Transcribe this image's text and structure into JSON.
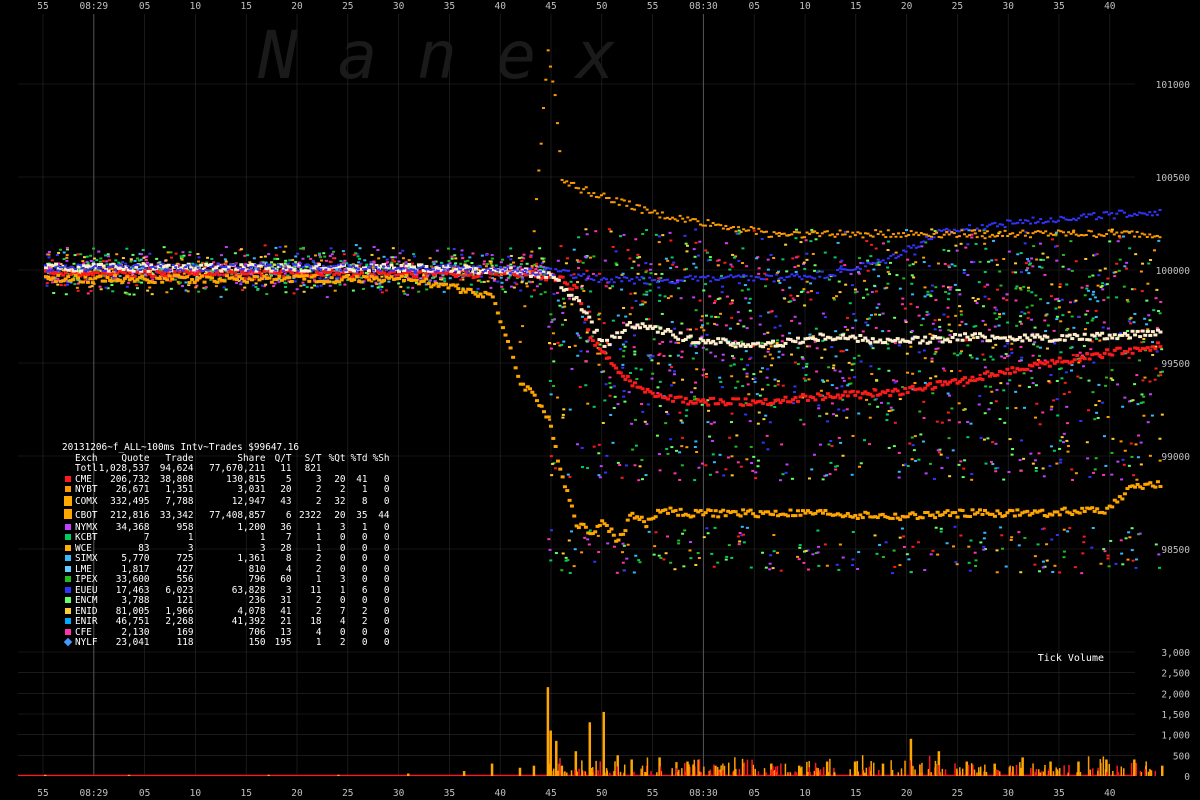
{
  "watermark": "N a n e x",
  "colors": {
    "background": "#000000",
    "grid": "#2a2a2a",
    "axis_text": "#c0c0c0",
    "vline": "#555555",
    "CME": "#ff1a1a",
    "NYBT": "#ff9900",
    "COMX": "#ffaa00",
    "CBOT": "#ffa500",
    "NYMX": "#c040ff",
    "KCBT": "#00cc66",
    "WCE": "#ffb000",
    "SIMX": "#33bbff",
    "LME": "#66ccff",
    "IPEX": "#22bb22",
    "EUEU": "#3333ff",
    "ENCM": "#66ff66",
    "ENID": "#ffcc33",
    "ENIR": "#00aaff",
    "CFE": "#ff33aa",
    "NYLF": "#4499ff",
    "band_white": "#ffeecc"
  },
  "x_axis_top": [
    "55",
    "08:29",
    "05",
    "10",
    "15",
    "20",
    "25",
    "30",
    "35",
    "40",
    "45",
    "50",
    "55",
    "08:30",
    "05",
    "10",
    "15",
    "20",
    "25",
    "30",
    "35",
    "40"
  ],
  "x_axis_bottom": [
    "55",
    "08:29",
    "05",
    "10",
    "15",
    "20",
    "25",
    "30",
    "35",
    "40",
    "45",
    "50",
    "55",
    "08:30",
    "05",
    "10",
    "15",
    "20",
    "25",
    "30",
    "35",
    "40"
  ],
  "price_axis": [
    "101000",
    "100500",
    "100000",
    "99500",
    "99000",
    "98500"
  ],
  "volume_axis": [
    "3,000",
    "2,500",
    "2,000",
    "1,500",
    "1,000",
    "500",
    "0"
  ],
  "volume_label": "Tick Volume",
  "stats": {
    "title": "20131206~f_ALL~100ms Intv~Trades $99647.16",
    "columns": [
      "Exch",
      "Quote",
      "Trade",
      "Share",
      "Q/T",
      "S/T",
      "%Qt",
      "%Td",
      "%Sh"
    ],
    "total": {
      "name": "Totl",
      "quote": "1,028,537",
      "trade": "94,624",
      "share": "77,670,211",
      "qt": "11",
      "st": "821",
      "pq": "",
      "pt": "",
      "ps": ""
    },
    "rows": [
      {
        "name": "CME",
        "quote": "206,732",
        "trade": "38,808",
        "share": "130,815",
        "qt": "5",
        "st": "3",
        "pq": "20",
        "pt": "41",
        "ps": "0",
        "color": "#ff1a1a",
        "shape": "sq"
      },
      {
        "name": "NYBT",
        "quote": "26,671",
        "trade": "1,351",
        "share": "3,031",
        "qt": "20",
        "st": "2",
        "pq": "2",
        "pt": "1",
        "ps": "0",
        "color": "#ff9900",
        "shape": "sq"
      },
      {
        "name": "COMX",
        "quote": "332,495",
        "trade": "7,788",
        "share": "12,947",
        "qt": "43",
        "st": "2",
        "pq": "32",
        "pt": "8",
        "ps": "0",
        "color": "#ffaa00",
        "shape": "big"
      },
      {
        "name": "CBOT",
        "quote": "212,816",
        "trade": "33,342",
        "share": "77,408,857",
        "qt": "6",
        "st": "2322",
        "pq": "20",
        "pt": "35",
        "ps": "44",
        "color": "#ffa500",
        "shape": "big"
      },
      {
        "name": "NYMX",
        "quote": "34,368",
        "trade": "958",
        "share": "1,200",
        "qt": "36",
        "st": "1",
        "pq": "3",
        "pt": "1",
        "ps": "0",
        "color": "#c040ff",
        "shape": "sq"
      },
      {
        "name": "KCBT",
        "quote": "7",
        "trade": "1",
        "share": "1",
        "qt": "7",
        "st": "1",
        "pq": "0",
        "pt": "0",
        "ps": "0",
        "color": "#00cc66",
        "shape": "sq"
      },
      {
        "name": "WCE",
        "quote": "83",
        "trade": "3",
        "share": "3",
        "qt": "28",
        "st": "1",
        "pq": "0",
        "pt": "0",
        "ps": "0",
        "color": "#ffb000",
        "shape": "sq"
      },
      {
        "name": "SIMX",
        "quote": "5,770",
        "trade": "725",
        "share": "1,361",
        "qt": "8",
        "st": "2",
        "pq": "0",
        "pt": "0",
        "ps": "0",
        "color": "#33bbff",
        "shape": "sq"
      },
      {
        "name": "LME",
        "quote": "1,817",
        "trade": "427",
        "share": "810",
        "qt": "4",
        "st": "2",
        "pq": "0",
        "pt": "0",
        "ps": "0",
        "color": "#66ccff",
        "shape": "sq"
      },
      {
        "name": "IPEX",
        "quote": "33,600",
        "trade": "556",
        "share": "796",
        "qt": "60",
        "st": "1",
        "pq": "3",
        "pt": "0",
        "ps": "0",
        "color": "#22bb22",
        "shape": "sq"
      },
      {
        "name": "EUEU",
        "quote": "17,463",
        "trade": "6,023",
        "share": "63,828",
        "qt": "3",
        "st": "11",
        "pq": "1",
        "pt": "6",
        "ps": "0",
        "color": "#3333ff",
        "shape": "sq"
      },
      {
        "name": "ENCM",
        "quote": "3,788",
        "trade": "121",
        "share": "236",
        "qt": "31",
        "st": "2",
        "pq": "0",
        "pt": "0",
        "ps": "0",
        "color": "#66ff66",
        "shape": "sq"
      },
      {
        "name": "ENID",
        "quote": "81,005",
        "trade": "1,966",
        "share": "4,078",
        "qt": "41",
        "st": "2",
        "pq": "7",
        "pt": "2",
        "ps": "0",
        "color": "#ffcc33",
        "shape": "sq"
      },
      {
        "name": "ENIR",
        "quote": "46,751",
        "trade": "2,268",
        "share": "41,392",
        "qt": "21",
        "st": "18",
        "pq": "4",
        "pt": "2",
        "ps": "0",
        "color": "#00aaff",
        "shape": "sq"
      },
      {
        "name": "CFE",
        "quote": "2,130",
        "trade": "169",
        "share": "706",
        "qt": "13",
        "st": "4",
        "pq": "0",
        "pt": "0",
        "ps": "0",
        "color": "#ff33aa",
        "shape": "sq"
      },
      {
        "name": "NYLF",
        "quote": "23,041",
        "trade": "118",
        "share": "150",
        "qt": "195",
        "st": "1",
        "pq": "2",
        "pt": "0",
        "ps": "0",
        "color": "#4499ff",
        "shape": "dia"
      }
    ]
  },
  "chart_data": [
    {
      "type": "scatter",
      "title": "",
      "ylabel": "",
      "y_ticks": [
        101000,
        100500,
        100000,
        99500,
        99000,
        98500
      ],
      "ylim": [
        98200,
        101200
      ],
      "x_range_seconds": [
        -36,
        44
      ],
      "x_ticks_seconds": [
        -35,
        -30,
        -25,
        -20,
        -15,
        -10,
        -5,
        0,
        5,
        10,
        15,
        20,
        25,
        30,
        35,
        40
      ],
      "series": [
        {
          "name": "CME",
          "x": [
            -36,
            -30,
            -20,
            -10,
            -2,
            0,
            1,
            2,
            3,
            4,
            5,
            6,
            8,
            10,
            15,
            20,
            25,
            30,
            35,
            40,
            44
          ],
          "values": [
            100000,
            99990,
            99990,
            99980,
            99990,
            99970,
            99950,
            99900,
            99650,
            99550,
            99450,
            99400,
            99330,
            99300,
            99300,
            99330,
            99350,
            99420,
            99500,
            99560,
            99600
          ]
        },
        {
          "name": "CBOT",
          "x": [
            -36,
            -30,
            -20,
            -10,
            -4,
            -2,
            -1,
            0,
            1,
            2,
            3,
            4,
            5,
            6,
            7,
            8,
            10,
            15,
            20,
            25,
            30,
            35,
            40,
            42,
            44
          ],
          "values": [
            99960,
            99960,
            99960,
            99960,
            99870,
            99400,
            99340,
            99200,
            98900,
            98650,
            98600,
            98650,
            98550,
            98700,
            98640,
            98720,
            98700,
            98700,
            98700,
            98680,
            98700,
            98700,
            98720,
            98850,
            98850
          ]
        },
        {
          "name": "COMX",
          "x": [
            -36,
            -10,
            -2,
            0,
            2,
            4,
            6,
            10,
            15,
            20,
            25,
            30,
            35,
            40,
            44
          ],
          "values": [
            100020,
            100020,
            100000,
            99980,
            99850,
            99600,
            99720,
            99640,
            99600,
            99650,
            99620,
            99650,
            99640,
            99650,
            99680
          ]
        },
        {
          "name": "EUEU",
          "x": [
            -36,
            -10,
            -2,
            0,
            2,
            4,
            8,
            12,
            16,
            20,
            24,
            28,
            32,
            36,
            40,
            44
          ],
          "values": [
            100020,
            100020,
            100000,
            100000,
            99980,
            99950,
            99950,
            99960,
            99960,
            99980,
            100050,
            100200,
            100250,
            100280,
            100300,
            100320
          ]
        },
        {
          "name": "NYBT",
          "x": [
            -2,
            -1,
            0,
            0.5,
            1,
            2,
            4,
            8,
            12,
            16,
            20,
            24,
            28,
            32,
            36,
            40,
            44
          ],
          "values": [
            99600,
            100200,
            101200,
            100950,
            100500,
            100450,
            100400,
            100300,
            100250,
            100200,
            100200,
            100200,
            100200,
            100200,
            100200,
            100200,
            100200
          ]
        }
      ]
    },
    {
      "type": "bar",
      "title": "Tick Volume",
      "ylim": [
        0,
        3000
      ],
      "y_ticks": [
        0,
        500,
        1000,
        1500,
        2000,
        2500,
        3000
      ],
      "x": [
        -36,
        -30,
        -20,
        -15,
        -10,
        -6,
        -4,
        -2,
        -1,
        0,
        0.2,
        0.6,
        1,
        2,
        3,
        4,
        5,
        6,
        8,
        10,
        12,
        14,
        16,
        18,
        20,
        22,
        24,
        26,
        28,
        30,
        32,
        34,
        36,
        38,
        40,
        42,
        44
      ],
      "values": [
        30,
        30,
        30,
        30,
        60,
        120,
        300,
        200,
        250,
        2150,
        1100,
        850,
        250,
        600,
        1300,
        1550,
        500,
        400,
        450,
        350,
        250,
        300,
        300,
        250,
        350,
        350,
        300,
        900,
        600,
        350,
        300,
        450,
        350,
        350,
        400,
        400,
        250
      ]
    }
  ]
}
